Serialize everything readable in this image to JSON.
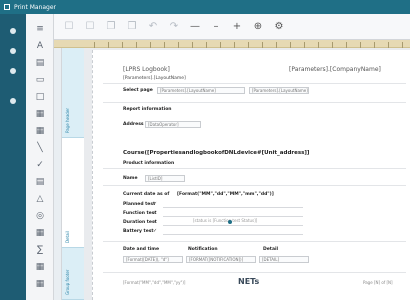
{
  "window": {
    "title": "Print Manager"
  },
  "toolbar": {
    "icons": [
      "save-icon",
      "save-as-icon",
      "copy-icon",
      "paste-icon",
      "undo-icon",
      "redo-icon",
      "minus-icon",
      "line-icon",
      "add-icon",
      "add-field-icon",
      "settings-icon"
    ],
    "glyphs": [
      "☐",
      "☐",
      "❐",
      "❒",
      "↶",
      "↷",
      "—",
      "–",
      "+",
      "⊕",
      "⚙"
    ]
  },
  "tools": {
    "glyphs": [
      "≡",
      "A",
      "▤",
      "▭",
      "□",
      "▦",
      "▦",
      "╲",
      "✓",
      "▤",
      "△",
      "◎",
      "▦",
      "∑",
      "▦",
      "▦"
    ]
  },
  "bands": [
    {
      "label": "Page header",
      "color": "#dbeef6"
    },
    {
      "label": "Detail",
      "color": "#ffffff"
    },
    {
      "label": "Group footer",
      "color": "#dbeef6"
    }
  ],
  "form": {
    "logo_placeholder": "[LPRS Logbook]",
    "company_placeholder": "[Parameters].[CompanyName]",
    "row1": "[Parameters].[LayoutName]",
    "select_label": "Select page",
    "select_value": "[Parameters].[LayoutName]",
    "select_value2": "[Parameters].[LayoutName]",
    "report_section": "Report information",
    "address_label": "Address",
    "address_value": "[DataOperator]",
    "title": "Course([PropertiesandlogbookofDNLdevice#[Unit_address]]",
    "product_info": "Product information",
    "name_label": "Name",
    "name_value": "[ListID]",
    "current_label": "Current date as of",
    "current_value": "[Format(\"MM\",\"dd\",\"MM\",\"mm\",\"dd\")]",
    "checks": [
      {
        "label": "Planned test",
        "mark": "✓"
      },
      {
        "label": "Function test",
        "mark": "✓",
        "note": "[status is [Function test Status]]"
      },
      {
        "label": "Duration test",
        "mark": "✓"
      },
      {
        "label": "Battery test",
        "mark": "✓"
      }
    ],
    "col_headers": [
      "Date and time",
      "Notification",
      "Detail"
    ],
    "col_values": [
      "[Format([DATE]), \"d\"]",
      "[FORMAT([NOTIFICATION])]",
      "[DETAIL]"
    ],
    "footer_left": "[Format(\"MM\",\"dd\",\"MM\",\"yy\")]",
    "footer_logo": "NETs",
    "footer_right": "Page [N] of [N]"
  }
}
